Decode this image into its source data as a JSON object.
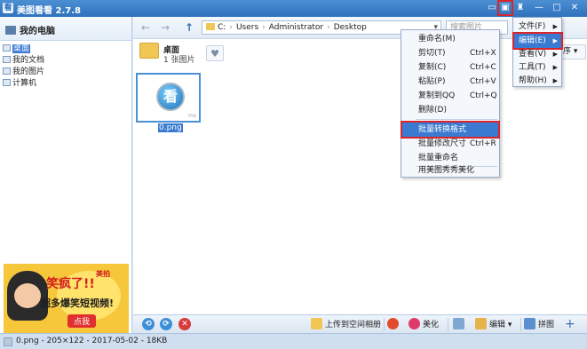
{
  "window": {
    "app_icon": "看",
    "title": "美图看看 2.7.8",
    "icons": [
      "chat-icon",
      "skin-icon",
      "shirt-icon",
      "min-icon",
      "max-icon",
      "close-icon"
    ],
    "controls": {
      "min": "—",
      "max": "□",
      "close": "✕"
    }
  },
  "left_pane": {
    "header": "我的电脑",
    "tree": [
      {
        "label": "桌面",
        "selected": true
      },
      {
        "label": "我的文档",
        "selected": false
      },
      {
        "label": "我的图片",
        "selected": false
      },
      {
        "label": "计算机",
        "selected": false
      }
    ],
    "ad": {
      "headline": "笑疯了!!",
      "brand": "美拍",
      "subline": "超多爆笑短视频!",
      "button": "点我"
    }
  },
  "toolbar": {
    "back": "←",
    "forward": "→",
    "up": "↑",
    "address": [
      "C:",
      "Users",
      "Administrator",
      "Desktop"
    ],
    "address_dropdown": "▾",
    "search_placeholder": "搜索图片",
    "sort_label": "序"
  },
  "folder": {
    "name": "桌面",
    "count": "1 张图片",
    "fav": "♥"
  },
  "thumbnail": {
    "glyph": "看",
    "tag": "ms",
    "filename": "0.png"
  },
  "bottombar": {
    "refresh1": "⟲",
    "refresh2": "⟳",
    "delete": "✕",
    "upload": "上传到空间相册",
    "beautify": "美化",
    "edit": "编辑",
    "puzzle": "拼图",
    "add": "+"
  },
  "statusbar": {
    "text": "0.png - 205×122 - 2017-05-02 - 18KB"
  },
  "right_menu": {
    "items": [
      {
        "label": "文件(F)",
        "active": false
      },
      {
        "label": "编辑(E)",
        "active": true
      },
      {
        "label": "查看(V)",
        "active": false
      },
      {
        "label": "工具(T)",
        "active": false
      },
      {
        "label": "帮助(H)",
        "active": false
      }
    ],
    "arrow": "▶"
  },
  "context_menu": {
    "items": [
      {
        "label": "重命名(M)",
        "shortcut": ""
      },
      {
        "label": "剪切(T)",
        "shortcut": "Ctrl+X"
      },
      {
        "label": "复制(C)",
        "shortcut": "Ctrl+C"
      },
      {
        "label": "粘贴(P)",
        "shortcut": "Ctrl+V"
      },
      {
        "label": "复制到QQ",
        "shortcut": "Ctrl+Q"
      },
      {
        "label": "删除(D)",
        "shortcut": ""
      },
      {
        "label": "批量转换格式",
        "shortcut": ""
      },
      {
        "label": "批量修改尺寸",
        "shortcut": "Ctrl+R"
      },
      {
        "label": "批量重命名",
        "shortcut": ""
      },
      {
        "label": "用美图秀秀美化",
        "shortcut": ""
      }
    ]
  }
}
